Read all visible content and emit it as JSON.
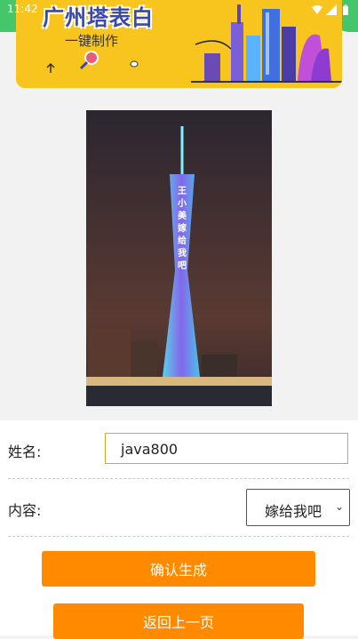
{
  "status_bar": {
    "time": "11:42",
    "icons": [
      "wifi-icon",
      "signal-icon",
      "battery-icon"
    ]
  },
  "banner": {
    "title": "广州塔表白",
    "subtitle": "一键制作"
  },
  "form": {
    "name_label": "姓名:",
    "name_value": "java800",
    "content_label": "内容:",
    "content_selected": "嫁给我吧"
  },
  "buttons": {
    "confirm": "确认生成",
    "back": "返回上一页"
  },
  "tower_text": "王小美嫁给我吧",
  "colors": {
    "banner_bg": "#f7c51e",
    "button": "#ff8a00",
    "input_border": "#e0a71a",
    "status_accent": "#45c66a"
  }
}
